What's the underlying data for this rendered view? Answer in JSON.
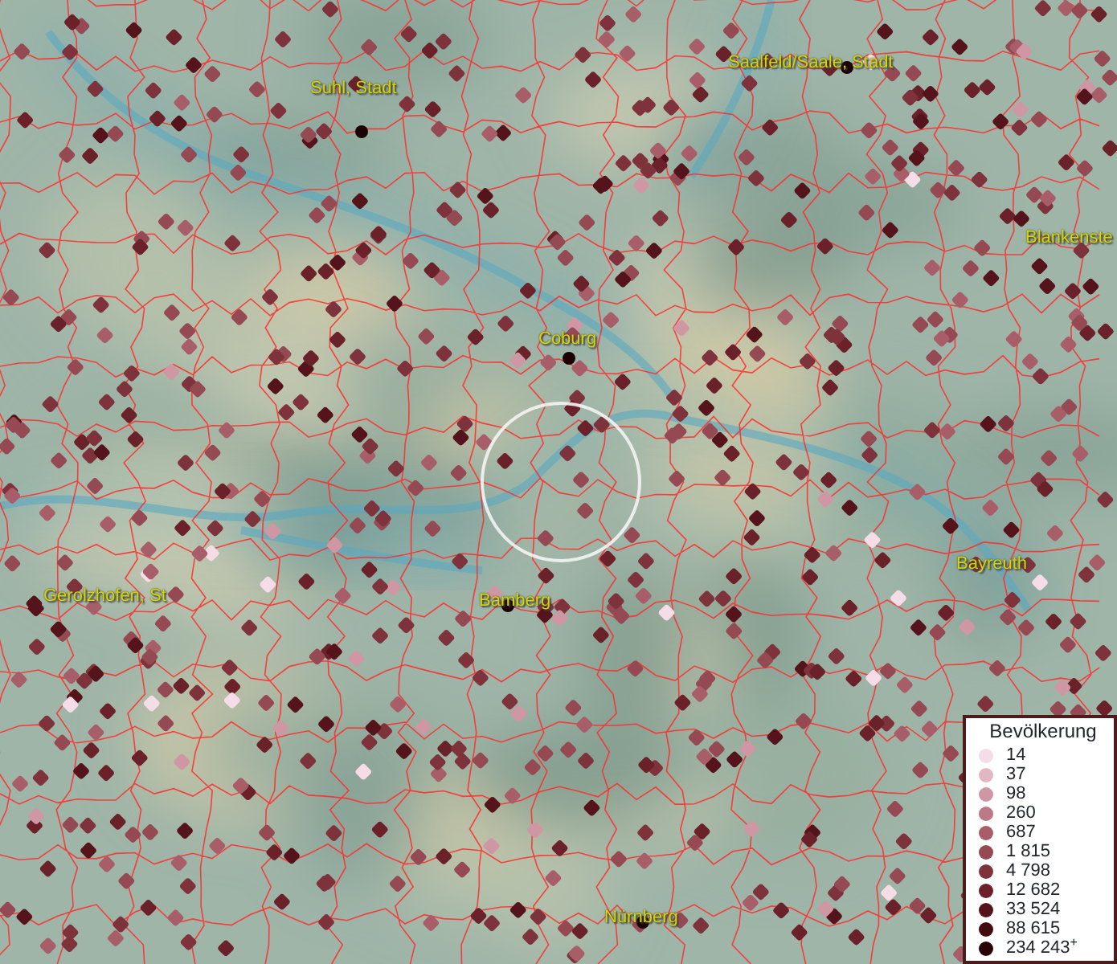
{
  "map": {
    "cities": [
      {
        "label": "Suhl, Stadt"
      },
      {
        "label": "Saalfeld/Saale, Stadt"
      },
      {
        "label": "Blankenste"
      },
      {
        "label": "Coburg"
      },
      {
        "label": "Bayreuth"
      },
      {
        "label": "Gerolzhofen, St"
      },
      {
        "label": "Bamberg"
      },
      {
        "label": "Nürnberg"
      }
    ]
  },
  "legend": {
    "title": "Bevölkerung",
    "items": [
      {
        "label": "14",
        "color": "#f5dce6"
      },
      {
        "label": "37",
        "color": "#e2b6c2"
      },
      {
        "label": "98",
        "color": "#cf97a3"
      },
      {
        "label": "260",
        "color": "#bc7a86"
      },
      {
        "label": "687",
        "color": "#a85e68"
      },
      {
        "label": "1 815",
        "color": "#944953"
      },
      {
        "label": "4 798",
        "color": "#7e333c"
      },
      {
        "label": "12 682",
        "color": "#6a2129"
      },
      {
        "label": "33 524",
        "color": "#55141b"
      },
      {
        "label": "88 615",
        "color": "#420b10"
      },
      {
        "label": "234 243$^{+}$",
        "color": "#2a0508"
      }
    ]
  }
}
